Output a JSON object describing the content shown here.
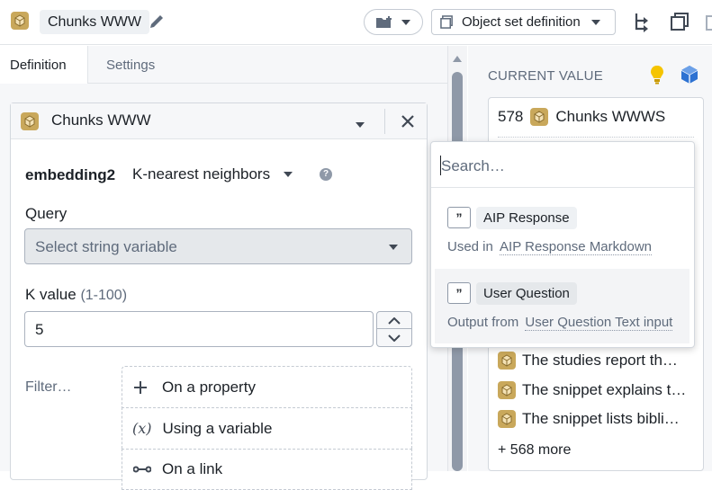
{
  "header": {
    "title": "Chunks WWW",
    "object_set_label": "Object set definition"
  },
  "tabs": [
    {
      "label": "Definition",
      "active": true
    },
    {
      "label": "Settings",
      "active": false
    }
  ],
  "card": {
    "title": "Chunks WWW",
    "property": "embedding2",
    "method": "K-nearest neighbors",
    "query_label": "Query",
    "query_placeholder": "Select string variable",
    "k_label": "K value",
    "k_range": "(1-100)",
    "k_value": "5",
    "filter_label": "Filter…",
    "filter_options": [
      {
        "label": "On a property",
        "icon": "plus-icon"
      },
      {
        "label": "Using a variable",
        "icon": "variable-icon"
      },
      {
        "label": "On a link",
        "icon": "link-icon"
      }
    ]
  },
  "right_panel": {
    "heading": "CURRENT VALUE",
    "count": "578",
    "object_name": "Chunks WWWS",
    "items": [
      "The studies report th…",
      "The snippet explains t…",
      "The snippet lists bibli…"
    ],
    "more": "+ 568 more"
  },
  "dropdown": {
    "search_placeholder": "Search…",
    "options": [
      {
        "label": "AIP Response",
        "prefix": "Used in",
        "ref": "AIP Response Markdown"
      },
      {
        "label": "User Question",
        "prefix": "Output from",
        "ref": "User Question Text input"
      }
    ]
  },
  "colors": {
    "accent_cube": "#c9a85b",
    "highlight_bg": "#f3f4f6",
    "blue_cube": "#2d72d2",
    "yellow_icon": "#f5c400"
  }
}
